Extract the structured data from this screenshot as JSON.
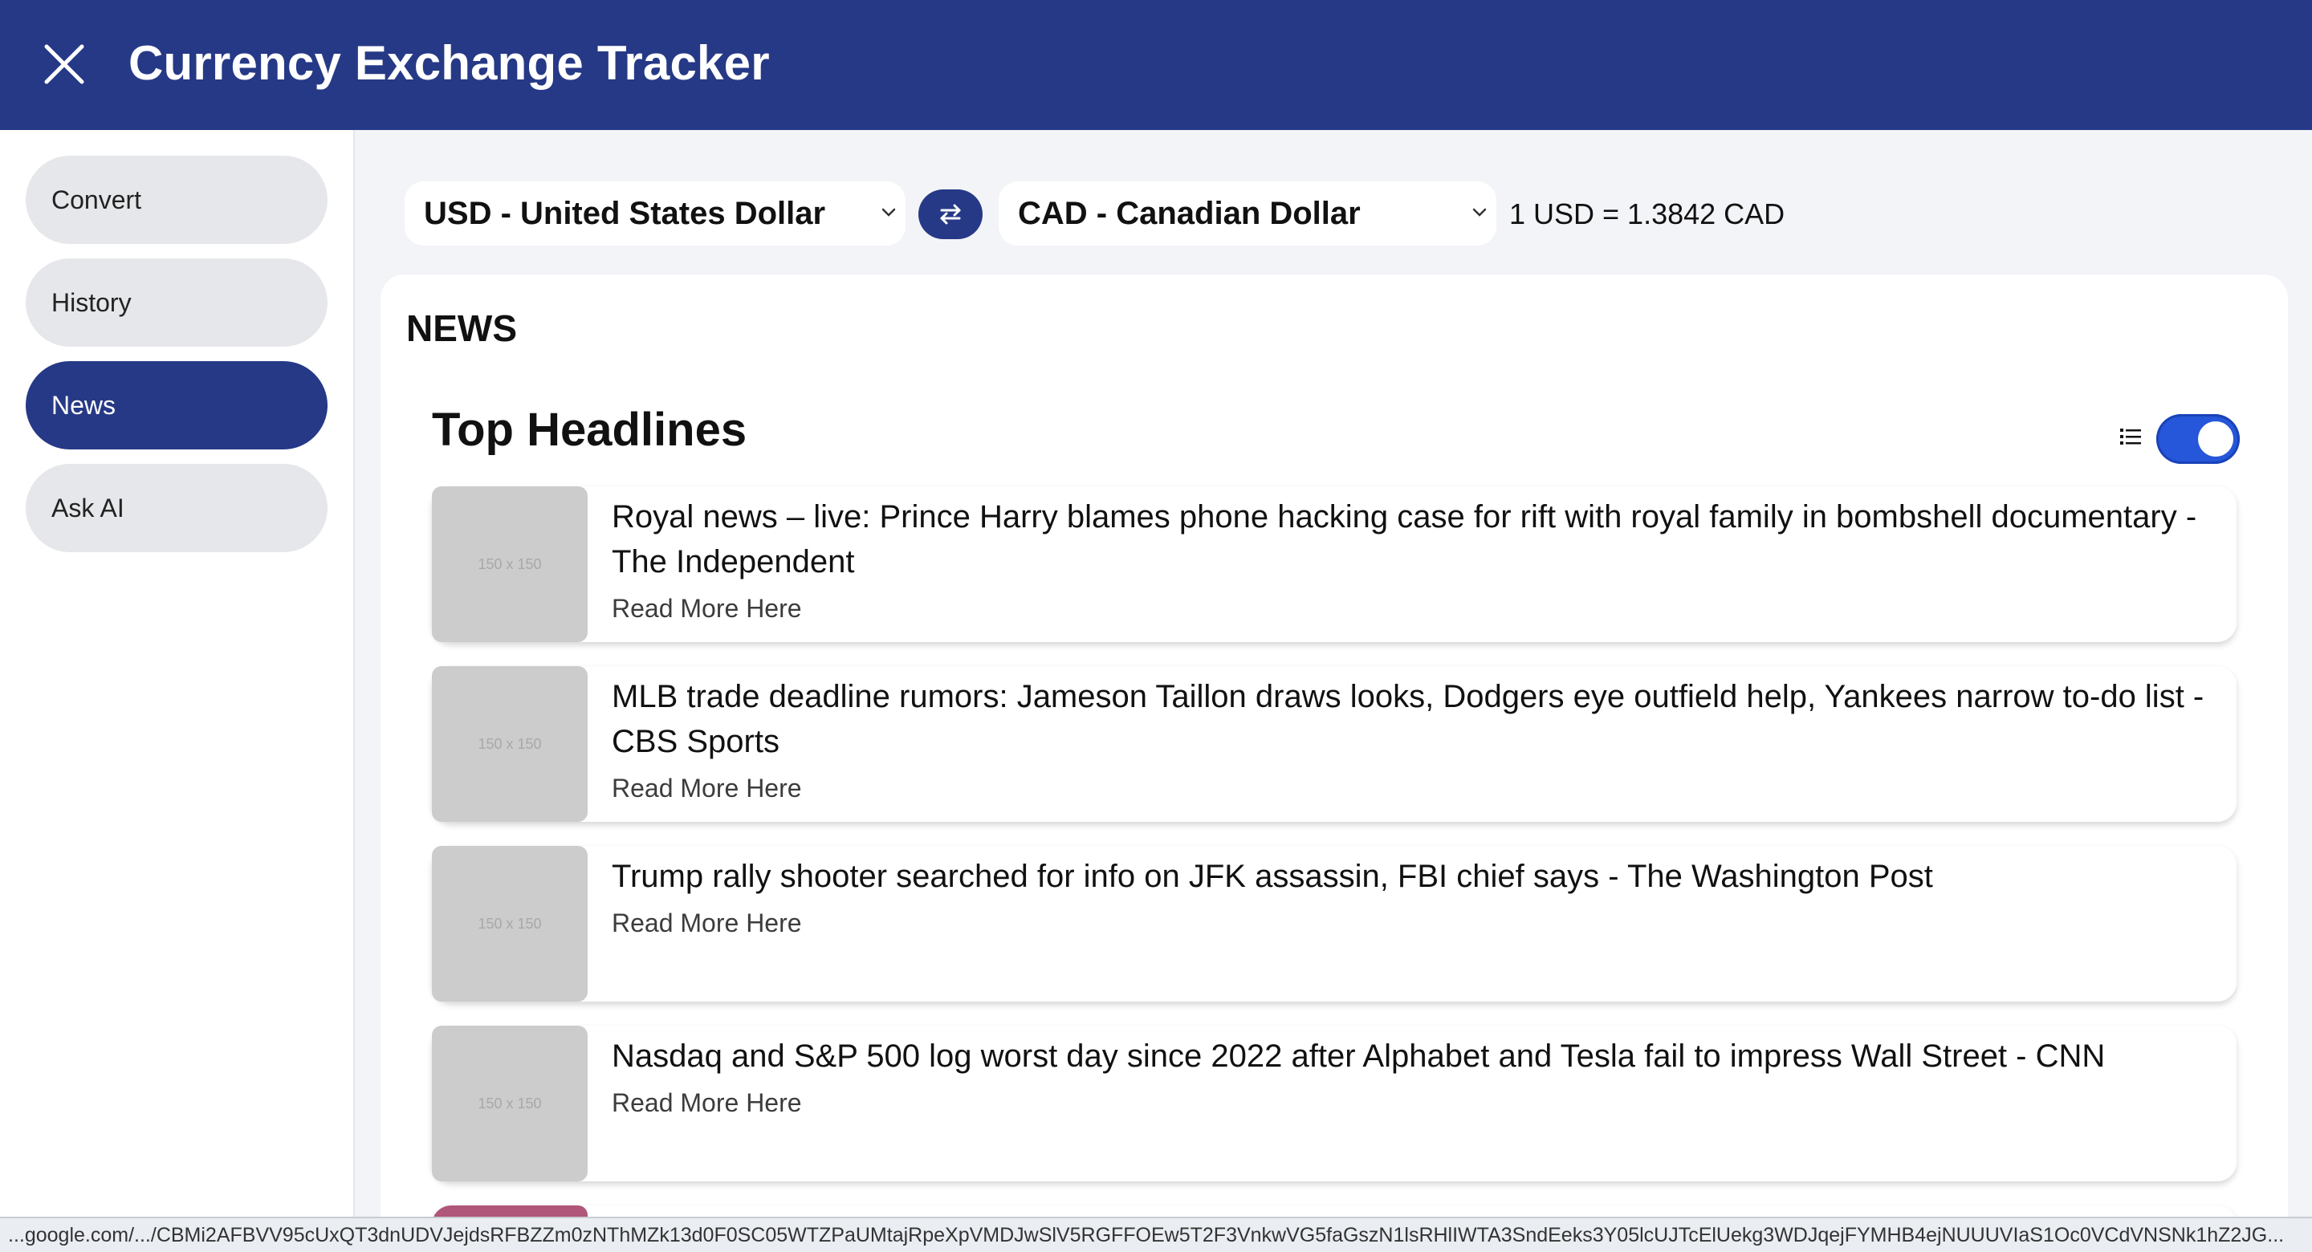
{
  "header": {
    "title": "Currency Exchange Tracker",
    "close_icon": "close-icon"
  },
  "sidebar": {
    "items": [
      {
        "label": "Convert",
        "active": false
      },
      {
        "label": "History",
        "active": false
      },
      {
        "label": "News",
        "active": true
      },
      {
        "label": "Ask AI",
        "active": false
      }
    ]
  },
  "converter": {
    "from_currency": "USD - United States Dollar",
    "to_currency": "CAD - Canadian Dollar",
    "swap_icon": "swap-arrows-icon",
    "rate_text": "1 USD = 1.3842 CAD"
  },
  "news": {
    "section_heading": "NEWS",
    "headlines_title": "Top Headlines",
    "view_toggle_on": true,
    "articles": [
      {
        "title": "Royal news – live: Prince Harry blames phone hacking case for rift with royal family in bombshell documentary - The Independent",
        "link_label": "Read More Here",
        "thumb_label": "150 x 150"
      },
      {
        "title": "MLB trade deadline rumors: Jameson Taillon draws looks, Dodgers eye outfield help, Yankees narrow to-do list - CBS Sports",
        "link_label": "Read More Here",
        "thumb_label": "150 x 150"
      },
      {
        "title": "Trump rally shooter searched for info on JFK assassin, FBI chief says - The Washington Post",
        "link_label": "Read More Here",
        "thumb_label": "150 x 150"
      },
      {
        "title": "Nasdaq and S&P 500 log worst day since 2022 after Alphabet and Tesla fail to impress Wall Street - CNN",
        "link_label": "Read More Here",
        "thumb_label": "150 x 150"
      }
    ]
  },
  "status_bar": {
    "url": "...google.com/.../CBMi2AFBVV95cUxQT3dnUDVJejdsRFBZZm0zNThMZk13d0F0SC05WTZPaUMtajRpeXpVMDJwSlV5RGFFOEw5T2F3VnkwVG5faGszN1lsRHlIWTA3SndEeks3Y05lcUJTcElUekg3WDJqejFYMHB4ejNUUUVIaS1Oc0VCdVNSNk1hZ2JG..."
  },
  "colors": {
    "brand": "#263986",
    "toggle_on": "#2656d9"
  }
}
